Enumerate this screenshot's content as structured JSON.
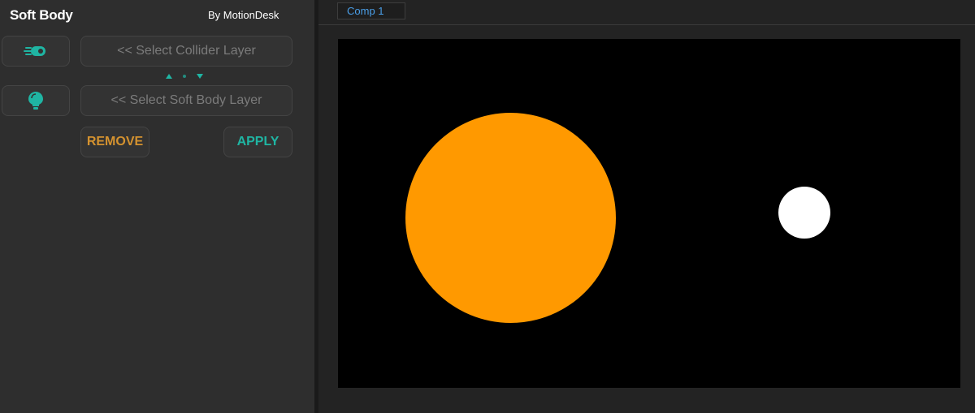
{
  "panel": {
    "title": "Soft Body",
    "author": "By MotionDesk",
    "collider_icon": "collider-icon",
    "softbody_icon": "softbody-icon",
    "collider_select_label": "<< Select Collider Layer",
    "softbody_select_label": "<< Select Soft Body Layer",
    "remove_label": "REMOVE",
    "apply_label": "APPLY",
    "accent_color": "#1fb5a3",
    "remove_color": "#d4922f"
  },
  "viewer": {
    "tab_label": "Comp 1",
    "canvas_background": "#000000",
    "layers": [
      {
        "name": "orange-ball",
        "color": "#ff9900"
      },
      {
        "name": "white-ball",
        "color": "#ffffff"
      }
    ]
  }
}
